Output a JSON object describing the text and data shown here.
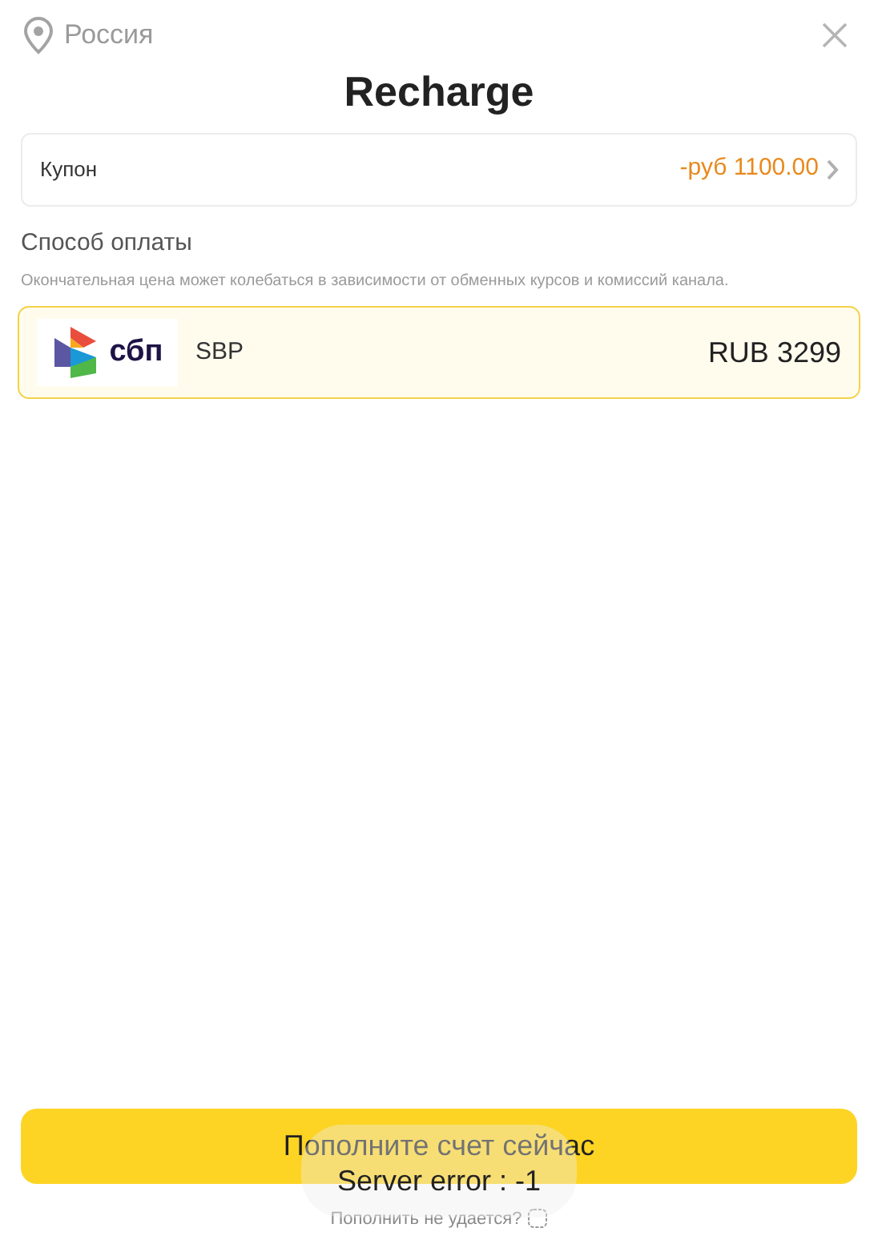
{
  "header": {
    "region": "Россия",
    "title": "Recharge"
  },
  "coupon": {
    "label": "Купон",
    "value": "-руб 1100.00"
  },
  "payment": {
    "heading": "Способ оплаты",
    "note": "Окончательная цена может колебаться в зависимости от обменных курсов и комиссий канала.",
    "methods": [
      {
        "name": "SBP",
        "logo_text": "сбп",
        "price": "RUB 3299",
        "selected": true
      }
    ]
  },
  "submit_button": "Пополните счет сейчас",
  "help_link": "Пополнить не удается?",
  "toast": "Server error : -1"
}
